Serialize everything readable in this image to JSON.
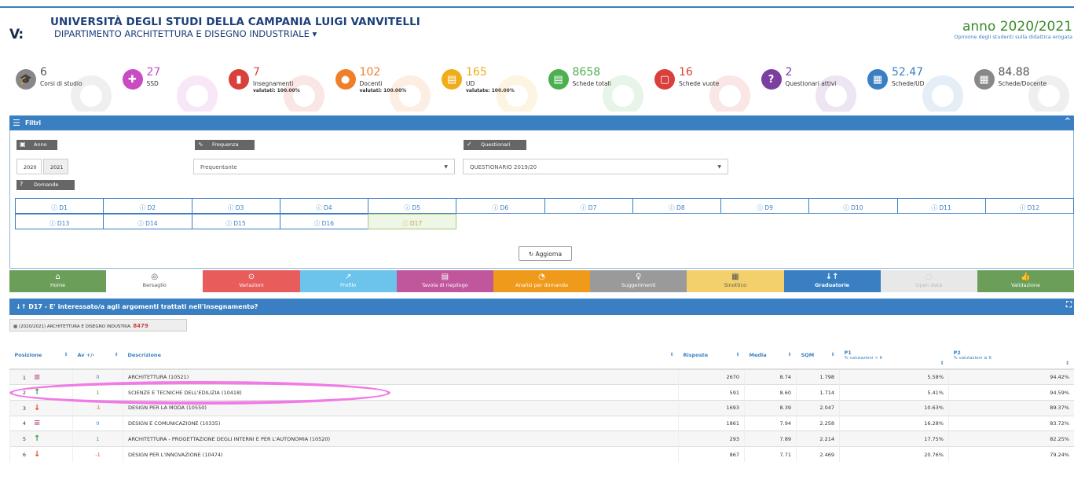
{
  "header": {
    "university": "UNIVERSITÀ DEGLI STUDI DELLA CAMPANIA LUIGI VANVITELLI",
    "department": "DIPARTIMENTO ARCHITETTURA E DISEGNO INDUSTRIALE",
    "year_label": "anno 2020/2021",
    "year_sub": "Opinione degli studenti sulla didattica erogata",
    "logo_text": "V:"
  },
  "stats": [
    {
      "num": "6",
      "label": "Corsi di studio",
      "sub": "",
      "color": "#888888",
      "icon": "graduation-icon"
    },
    {
      "num": "27",
      "label": "SSD",
      "sub": "",
      "color": "#c84bc4",
      "icon": "puzzle-icon"
    },
    {
      "num": "7",
      "label": "Insegnamenti",
      "sub": "valutati: 100.00%",
      "color": "#d9403b",
      "icon": "book-icon"
    },
    {
      "num": "102",
      "label": "Docenti",
      "sub": "valutati: 100.00%",
      "color": "#ef7f2a",
      "icon": "users-icon"
    },
    {
      "num": "165",
      "label": "UD",
      "sub": "valutate: 100.00%",
      "color": "#f0ad1b",
      "icon": "doc-icon"
    },
    {
      "num": "8658",
      "label": "Schede totali",
      "sub": "",
      "color": "#4caf50",
      "icon": "file-icon"
    },
    {
      "num": "16",
      "label": "Schede vuote",
      "sub": "",
      "color": "#d9403b",
      "icon": "empty-file-icon"
    },
    {
      "num": "2",
      "label": "Questionari attivi",
      "sub": "",
      "color": "#7b3fa0",
      "icon": "question-icon"
    },
    {
      "num": "52.47",
      "label": "Schede/UD",
      "sub": "",
      "color": "#3a7fc1",
      "icon": "calculator-icon"
    },
    {
      "num": "84.88",
      "label": "Schede/Docente",
      "sub": "",
      "color": "#888888",
      "icon": "calculator-icon"
    }
  ],
  "filters": {
    "title": "Filtri",
    "anno_label": "Anno",
    "anno_options": [
      "2020",
      "2021"
    ],
    "frequenza_label": "Frequenza",
    "frequenza_value": "Frequentante",
    "questionari_label": "Questionari",
    "questionari_value": "QUESTIONARIO 2019/20",
    "domande_label": "Domande",
    "domande": [
      "D1",
      "D2",
      "D3",
      "D4",
      "D5",
      "D6",
      "D7",
      "D8",
      "D9",
      "D10",
      "D11",
      "D12",
      "D13",
      "D14",
      "D15",
      "D16",
      "D17"
    ],
    "selected_domanda": "D17",
    "aggiorna": "Aggiorna"
  },
  "tabs": [
    {
      "label": "Home",
      "color": "#6a9e59",
      "icon": "home-icon"
    },
    {
      "label": "Bersaglio",
      "color": "#ffffff",
      "icon": "target-icon"
    },
    {
      "label": "Variazioni",
      "color": "#e85c5c",
      "icon": "variation-icon"
    },
    {
      "label": "Profilo",
      "color": "#6cc4ec",
      "icon": "chart-icon"
    },
    {
      "label": "Tavola di riepilogo",
      "color": "#c0569b",
      "icon": "table-icon"
    },
    {
      "label": "Analisi per domanda",
      "color": "#ef9a1a",
      "icon": "gauge-icon"
    },
    {
      "label": "Suggerimenti",
      "color": "#9a9a9a",
      "icon": "bulb-icon"
    },
    {
      "label": "Sinottico",
      "color": "#f4d06c",
      "icon": "grid-icon"
    },
    {
      "label": "Graduatorie",
      "color": "#3a7fc1",
      "icon": "sort-icon"
    },
    {
      "label": "Open data",
      "color": "#e8e8e8",
      "icon": "open-data-icon"
    },
    {
      "label": "Validazione",
      "color": "#6a9e59",
      "icon": "thumb-icon"
    }
  ],
  "results": {
    "title": "D17 - E' interessato/a agli argomenti trattati nell'insegnamento?",
    "crumb": "(2020/2021) ARCHITETTURA E DISEGNO INDUSTRIA.",
    "crumb_count": "8479",
    "columns": [
      "Posizione",
      "Av +/-",
      "Descrizione",
      "Risposte",
      "Media",
      "SQM",
      "P1",
      "% valutazioni < 6",
      "P2",
      "% valutazioni ≥ 6"
    ],
    "rows": [
      {
        "pos": "1",
        "trend": "eq",
        "av": "0",
        "desc": "ARCHITETTURA (10521)",
        "risposte": "2670",
        "media": "8.74",
        "sqm": "1.798",
        "p1": "5.58%",
        "p2": "94.42%"
      },
      {
        "pos": "2",
        "trend": "up",
        "av": "1",
        "desc": "SCIENZE E TECNICHE DELL'EDILIZIA (10418)",
        "risposte": "591",
        "media": "8.60",
        "sqm": "1.714",
        "p1": "5.41%",
        "p2": "94.59%"
      },
      {
        "pos": "3",
        "trend": "down",
        "av": "-1",
        "desc": "DESIGN PER LA MODA (10550)",
        "risposte": "1693",
        "media": "8.39",
        "sqm": "2.047",
        "p1": "10.63%",
        "p2": "89.37%"
      },
      {
        "pos": "4",
        "trend": "eq",
        "av": "0",
        "desc": "DESIGN E COMUNICAZIONE (10335)",
        "risposte": "1861",
        "media": "7.94",
        "sqm": "2.258",
        "p1": "16.28%",
        "p2": "83.72%"
      },
      {
        "pos": "5",
        "trend": "up",
        "av": "1",
        "desc": "ARCHITETTURA - PROGETTAZIONE DEGLI INTERNI E PER L'AUTONOMIA (10520)",
        "risposte": "293",
        "media": "7.89",
        "sqm": "2.214",
        "p1": "17.75%",
        "p2": "82.25%"
      },
      {
        "pos": "6",
        "trend": "down",
        "av": "-1",
        "desc": "DESIGN PER L'INNOVAZIONE (10474)",
        "risposte": "867",
        "media": "7.71",
        "sqm": "2.469",
        "p1": "20.76%",
        "p2": "79.24%"
      }
    ]
  }
}
